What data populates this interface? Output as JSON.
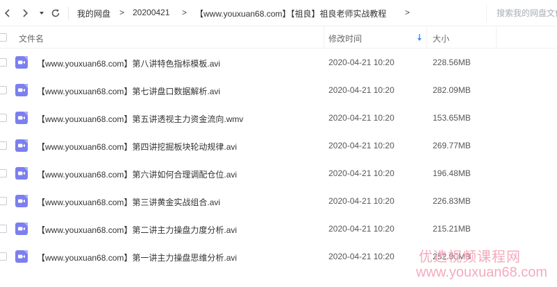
{
  "toolbar": {
    "breadcrumbs": [
      "我的网盘",
      "20200421",
      "【www.youxuan68.com】【祖良】祖良老师实战教程"
    ],
    "separator": ">",
    "search_placeholder": "搜索我的网盘文件"
  },
  "table": {
    "col_name": "文件名",
    "col_time": "修改时间",
    "col_size": "大小",
    "rows": [
      {
        "name": "【www.youxuan68.com】第八讲特色指标模板.avi",
        "time": "2020-04-21 10:20",
        "size": "228.56MB"
      },
      {
        "name": "【www.youxuan68.com】第七讲盘口数据解析.avi",
        "time": "2020-04-21 10:20",
        "size": "282.09MB"
      },
      {
        "name": "【www.youxuan68.com】第五讲透视主力资金流向.wmv",
        "time": "2020-04-21 10:20",
        "size": "153.65MB"
      },
      {
        "name": "【www.youxuan68.com】第四讲挖掘板块轮动规律.avi",
        "time": "2020-04-21 10:20",
        "size": "269.77MB"
      },
      {
        "name": "【www.youxuan68.com】第六讲如何合理调配仓位.avi",
        "time": "2020-04-21 10:20",
        "size": "196.48MB"
      },
      {
        "name": "【www.youxuan68.com】第三讲黄金实战组合.avi",
        "time": "2020-04-21 10:20",
        "size": "226.83MB"
      },
      {
        "name": "【www.youxuan68.com】第二讲主力操盘力度分析.avi",
        "time": "2020-04-21 10:20",
        "size": "215.21MB"
      },
      {
        "name": "【www.youxuan68.com】第一讲主力操盘思维分析.avi",
        "time": "2020-04-21 10:20",
        "size": "252.90MB"
      }
    ]
  },
  "watermark": {
    "line1": "优选视频课程网",
    "line2": "www.youxuan68.com"
  },
  "colors": {
    "video_icon": "#7b7ff0",
    "sort_arrow": "#3b8cff",
    "watermark": "#f5a9bd"
  },
  "icons": {
    "back": "chevron-left-icon",
    "forward": "chevron-right-icon",
    "history": "caret-down-icon",
    "refresh": "refresh-icon",
    "file": "video-file-icon",
    "sort": "sort-down-icon"
  }
}
